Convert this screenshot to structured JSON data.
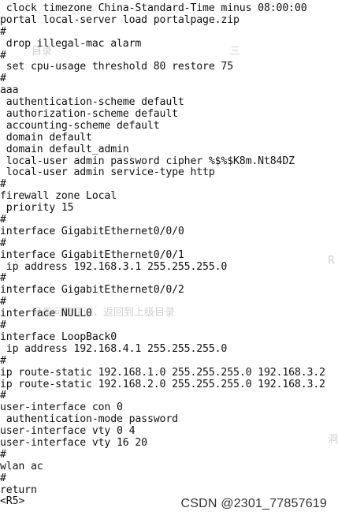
{
  "terminal": {
    "lines": [
      " clock timezone China-Standard-Time minus 08:00:00",
      "portal local-server load portalpage.zip",
      "#",
      " drop illegal-mac alarm",
      "#",
      " set cpu-usage threshold 80 restore 75",
      "#",
      "aaa",
      " authentication-scheme default",
      " authorization-scheme default",
      " accounting-scheme default",
      " domain default",
      " domain default_admin",
      " local-user admin password cipher %$%$K8m.Nt84DZ",
      " local-user admin service-type http",
      "#",
      "firewall zone Local",
      " priority 15",
      "#",
      "interface GigabitEthernet0/0/0",
      "#",
      "interface GigabitEthernet0/0/1",
      " ip address 192.168.3.1 255.255.255.0",
      "#",
      "interface GigabitEthernet0/0/2",
      "#",
      "interface NULL0",
      "#",
      "interface LoopBack0",
      " ip address 192.168.4.1 255.255.255.0",
      "#",
      "ip route-static 192.168.1.0 255.255.255.0 192.168.3.2",
      "ip route-static 192.168.2.0 255.255.255.0 192.168.3.2",
      "#",
      "user-interface con 0",
      " authentication-mode password",
      "user-interface vty 0 4",
      "user-interface vty 16 20",
      "#",
      "wlan ac",
      "#",
      "return",
      "<R5>"
    ]
  },
  "overlay": {
    "ghost_text_1": "目录",
    "ghost_text_2": "三",
    "ghost_text_3": "另类问题调试，返回到上级目录",
    "ghost_text_4": "R",
    "ghost_text_5": "洞"
  },
  "watermark": {
    "text": "CSDN @2301_77857619"
  }
}
